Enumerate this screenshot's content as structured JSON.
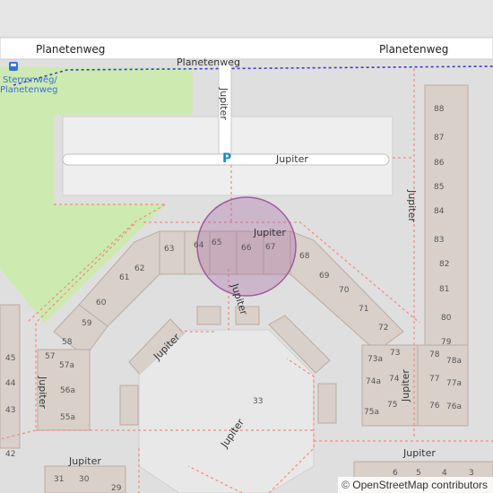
{
  "streets": {
    "planetenweg_left": "Planetenweg",
    "planetenweg_right": "Planetenweg",
    "planetenweg_center": "Planetenweg",
    "jupiter_labels": [
      "Jupiter",
      "Jupiter",
      "Jupiter",
      "Jupiter",
      "Jupiter",
      "Jupiter",
      "Jupiter",
      "Jupiter",
      "Jupiter",
      "Jupiter",
      "Jupiter"
    ]
  },
  "transit_stop": {
    "line1": "Sterrenweg/",
    "line2": "Planetenweg"
  },
  "parking": {
    "symbol": "P"
  },
  "highlight": {
    "color": "#a05a9f"
  },
  "house_numbers": {
    "right_column": [
      "88",
      "87",
      "86",
      "85",
      "84",
      "83",
      "82",
      "81",
      "80",
      "79",
      "78",
      "78a",
      "77",
      "77a",
      "76",
      "76a"
    ],
    "top_row": [
      "63",
      "64",
      "65",
      "66",
      "67",
      "68"
    ],
    "left_diagonal": [
      "62",
      "61",
      "60",
      "59",
      "58",
      "57",
      "57a",
      "56a",
      "55a"
    ],
    "right_diagonal": [
      "69",
      "70",
      "71",
      "72",
      "73",
      "73a",
      "74",
      "74a",
      "75",
      "75a"
    ],
    "far_left": [
      "45",
      "44",
      "43",
      "42"
    ],
    "bottom": [
      "33",
      "31",
      "30",
      "29"
    ],
    "bottom_right": [
      "6",
      "5",
      "4",
      "3"
    ]
  },
  "attribution": {
    "symbol": "©",
    "text": "OpenStreetMap contributors"
  }
}
